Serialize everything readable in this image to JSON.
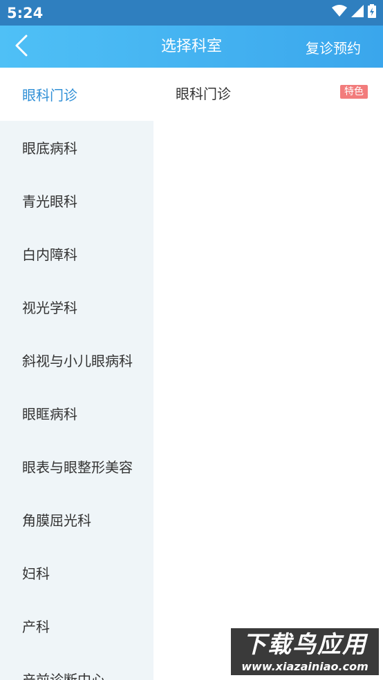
{
  "status_bar": {
    "time": "5:24",
    "icons": [
      "wifi-icon",
      "signal-icon",
      "battery-icon"
    ]
  },
  "header": {
    "back_icon": "chevron-left-icon",
    "title": "选择科室",
    "right_action": "复诊预约"
  },
  "sidebar": {
    "items": [
      {
        "label": "眼科门诊",
        "active": true
      },
      {
        "label": "眼底病科"
      },
      {
        "label": "青光眼科"
      },
      {
        "label": "白内障科"
      },
      {
        "label": "视光学科"
      },
      {
        "label": "斜视与小儿眼病科"
      },
      {
        "label": "眼眶病科"
      },
      {
        "label": "眼表与眼整形美容"
      },
      {
        "label": "角膜屈光科"
      },
      {
        "label": "妇科"
      },
      {
        "label": "产科"
      },
      {
        "label": "产前诊断中心"
      }
    ]
  },
  "content": {
    "departments": [
      {
        "label": "眼科门诊",
        "badge": "特色"
      }
    ]
  },
  "watermark": {
    "main": "下载鸟应用",
    "url": "www.xiazainiao.com"
  },
  "colors": {
    "status_bar": "#2f7fbf",
    "header_start": "#4fc0f6",
    "header_end": "#3aa6ec",
    "sidebar_bg": "#eff5f8",
    "active_text": "#2f8fd6",
    "badge": "#f27c7c"
  }
}
